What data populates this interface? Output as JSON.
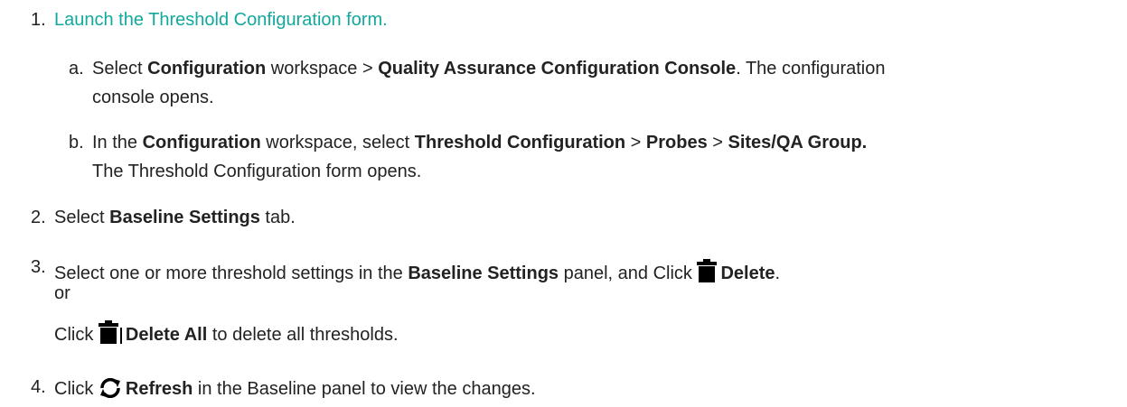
{
  "steps": [
    {
      "num": "1.",
      "link_text": "Launch the Threshold Configuration form."
    },
    {
      "num": "2.",
      "pre": "Select ",
      "bold": "Baseline Settings",
      "post": " tab."
    },
    {
      "num": "3.",
      "pre": "Select one or more threshold settings in the ",
      "bold1": "Baseline Settings",
      "mid": " panel, and Click ",
      "bold2": "Delete",
      "post": ".",
      "or": "or",
      "line2_pre": "Click ",
      "line2_bold": "Delete All",
      "line2_post": " to delete all thresholds."
    },
    {
      "num": "4.",
      "pre": "Click ",
      "bold": "Refresh",
      "post": " in the Baseline panel to view the changes."
    }
  ],
  "substeps": [
    {
      "letter": "a.",
      "t1": "Select ",
      "b1": "Configuration",
      "t2": " workspace > ",
      "b2": "Quality Assurance Configuration Console",
      "t3": ". The configuration",
      "line2": "console opens."
    },
    {
      "letter": "b.",
      "t1": "In the ",
      "b1": "Configuration",
      "t2": " workspace, select ",
      "b2": "Threshold Configuration",
      "t3": " > ",
      "b3": "Probes",
      "t4": " > ",
      "b4": "Sites/QA Group.",
      "line2": "The Threshold Configuration form opens."
    }
  ],
  "icons": {
    "delete": "trash-icon",
    "delete_all": "trash-all-icon",
    "refresh": "refresh-icon"
  },
  "colors": {
    "link": "#13a89e",
    "text": "#222222"
  }
}
